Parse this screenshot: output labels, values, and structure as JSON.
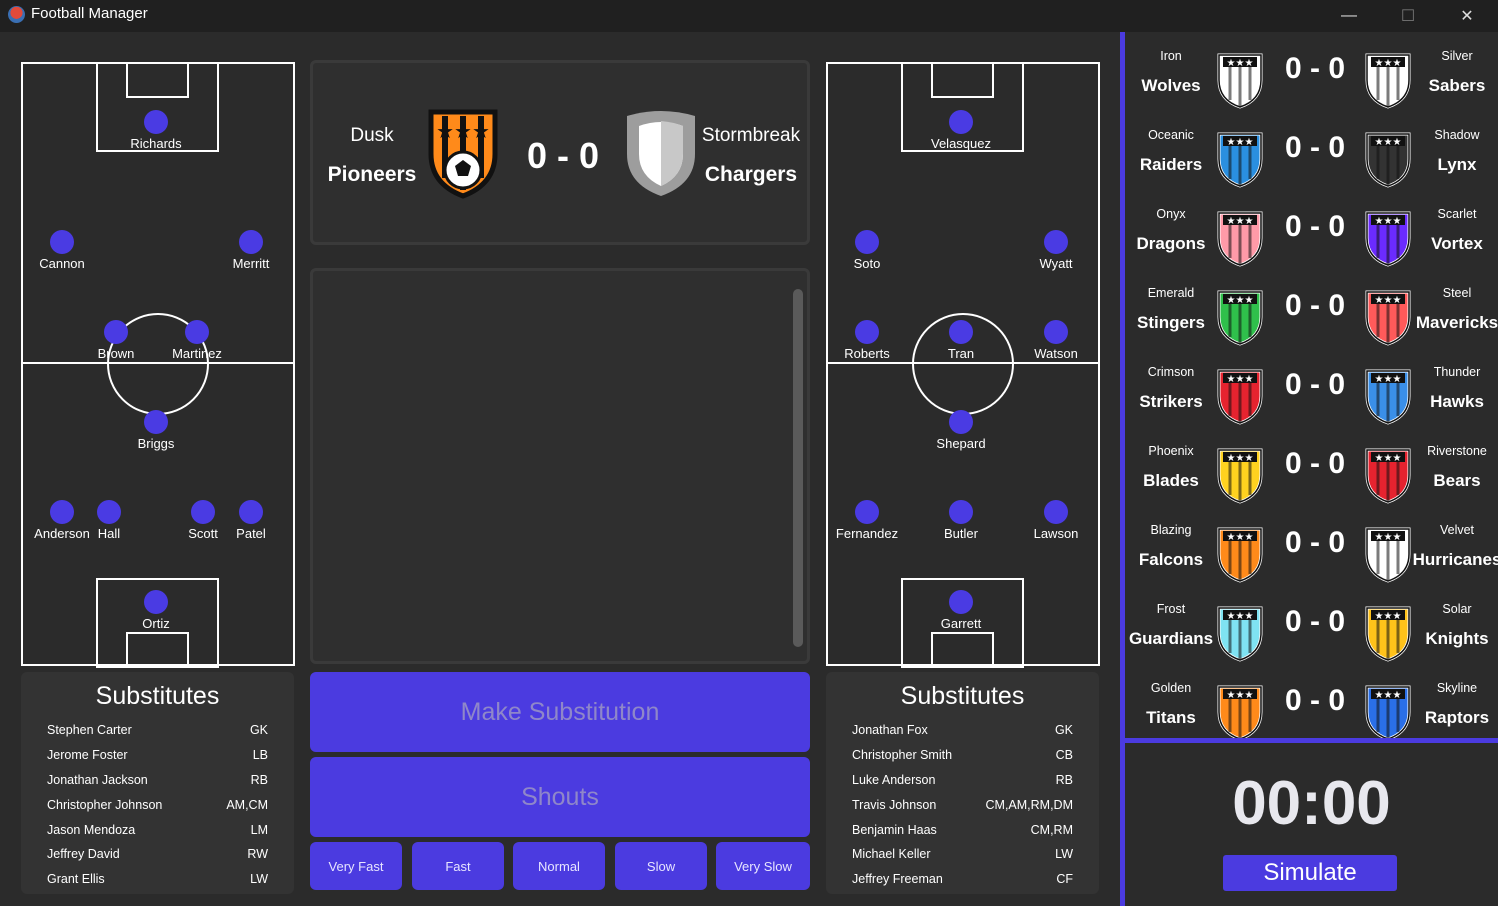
{
  "window": {
    "title": "Football Manager",
    "minimize": "—",
    "maximize": "☐",
    "close": "✕"
  },
  "home_pitch": {
    "players": [
      "Richards",
      "Cannon",
      "Merritt",
      "Brown",
      "Martinez",
      "Briggs",
      "Anderson",
      "Hall",
      "Scott",
      "Patel",
      "Ortiz"
    ]
  },
  "away_pitch": {
    "players": [
      "Velasquez",
      "Soto",
      "Wyatt",
      "Roberts",
      "Tran",
      "Watson",
      "Shepard",
      "Fernandez",
      "Butler",
      "Lawson",
      "Garrett"
    ]
  },
  "scoreboard": {
    "home_city": "Dusk",
    "home_name": "Pioneers",
    "score": "0 - 0",
    "away_city": "Stormbreak",
    "away_name": "Chargers"
  },
  "home_subs": {
    "title": "Substitutes",
    "rows": [
      [
        "Stephen Carter",
        "GK"
      ],
      [
        "Jerome Foster",
        "LB"
      ],
      [
        "Jonathan Jackson",
        "RB"
      ],
      [
        "Christopher Johnson",
        "AM,CM"
      ],
      [
        "Jason Mendoza",
        "LM"
      ],
      [
        "Jeffrey David",
        "RW"
      ],
      [
        "Grant Ellis",
        "LW"
      ]
    ]
  },
  "away_subs": {
    "title": "Substitutes",
    "rows": [
      [
        "Jonathan Fox",
        "GK"
      ],
      [
        "Christopher Smith",
        "CB"
      ],
      [
        "Luke Anderson",
        "RB"
      ],
      [
        "Travis Johnson",
        "CM,AM,RM,DM"
      ],
      [
        "Benjamin Haas",
        "CM,RM"
      ],
      [
        "Michael Keller",
        "LW"
      ],
      [
        "Jeffrey Freeman",
        "CF"
      ]
    ]
  },
  "buttons": {
    "make_sub": "Make Substitution",
    "shouts": "Shouts",
    "speeds": [
      "Very Fast",
      "Fast",
      "Normal",
      "Slow",
      "Very Slow"
    ]
  },
  "matches": [
    {
      "h1": "Iron",
      "h2": "Wolves",
      "s": "0 - 0",
      "a1": "Silver",
      "a2": "Sabers"
    },
    {
      "h1": "Oceanic",
      "h2": "Raiders",
      "s": "0 - 0",
      "a1": "Shadow",
      "a2": "Lynx"
    },
    {
      "h1": "Onyx",
      "h2": "Dragons",
      "s": "0 - 0",
      "a1": "Scarlet",
      "a2": "Vortex"
    },
    {
      "h1": "Emerald",
      "h2": "Stingers",
      "s": "0 - 0",
      "a1": "Steel",
      "a2": "Mavericks"
    },
    {
      "h1": "Crimson",
      "h2": "Strikers",
      "s": "0 - 0",
      "a1": "Thunder",
      "a2": "Hawks"
    },
    {
      "h1": "Phoenix",
      "h2": "Blades",
      "s": "0 - 0",
      "a1": "Riverstone",
      "a2": "Bears"
    },
    {
      "h1": "Blazing",
      "h2": "Falcons",
      "s": "0 - 0",
      "a1": "Velvet",
      "a2": "Hurricanes"
    },
    {
      "h1": "Frost",
      "h2": "Guardians",
      "s": "0 - 0",
      "a1": "Solar",
      "a2": "Knights"
    },
    {
      "h1": "Golden",
      "h2": "Titans",
      "s": "0 - 0",
      "a1": "Skyline",
      "a2": "Raptors"
    }
  ],
  "crest_colors": {
    "home": [
      "#ffffff",
      "#2a8fe0",
      "#ff9aa8",
      "#2fc04b",
      "#e6232f",
      "#ffd21f",
      "#ff8a1a",
      "#7fe3f2",
      "#ff8a1a"
    ],
    "away": [
      "#ffffff",
      "#333333",
      "#6b2bff",
      "#ff5a5a",
      "#3a8fe8",
      "#e6232f",
      "#ffffff",
      "#ffc21a",
      "#2a6fe8"
    ]
  },
  "clock": {
    "time": "00:00",
    "simulate": "Simulate"
  },
  "accent": "#4b3be0"
}
